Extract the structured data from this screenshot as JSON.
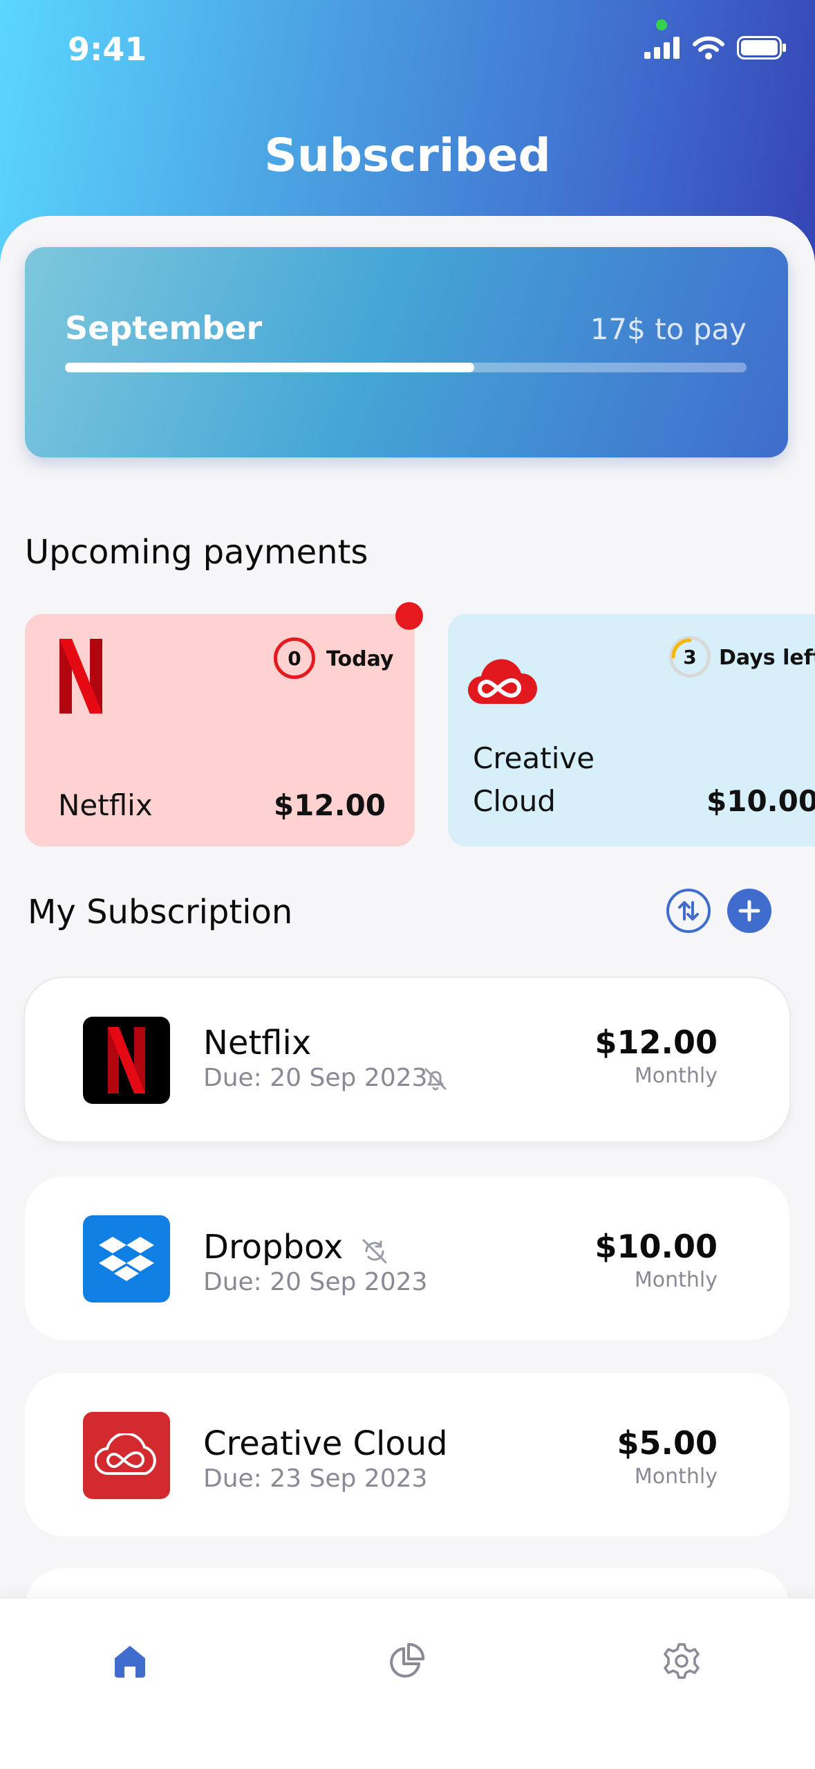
{
  "status_bar": {
    "time": "9:41"
  },
  "header": {
    "title": "Subscribed"
  },
  "month_card": {
    "month": "September",
    "to_pay": "17$ to pay",
    "progress_fraction": 0.6
  },
  "upcoming": {
    "title": "Upcoming payments",
    "cards": [
      {
        "name": "Netflix",
        "price": "$12.00",
        "days": "0",
        "badge_label": "Today",
        "color": "#ffd2d2"
      },
      {
        "name_line1": "Creative",
        "name_line2": "Cloud",
        "price": "$10.00",
        "days": "3",
        "badge_label": "Days left",
        "color": "#d7eff9"
      }
    ]
  },
  "subscriptions": {
    "title": "My Subscription",
    "items": [
      {
        "name": "Netflix",
        "due": "Due: 20 Sep 2023",
        "price": "$12.00",
        "cycle": "Monthly",
        "icon": "netflix-logo",
        "status_icon": "bell-off-icon"
      },
      {
        "name": "Dropbox",
        "due": "Due: 20 Sep 2023",
        "price": "$10.00",
        "cycle": "Monthly",
        "icon": "dropbox-logo",
        "status_icon": "autorenew-off-icon"
      },
      {
        "name": "Creative Cloud",
        "due": "Due: 23 Sep 2023",
        "price": "$5.00",
        "cycle": "Monthly",
        "icon": "creative-cloud-logo"
      }
    ]
  },
  "tabbar": {
    "items": [
      "home-icon",
      "chart-icon",
      "settings-icon"
    ],
    "active": "home-icon"
  },
  "colors": {
    "accent": "#3f6ccd",
    "netflix_red": "#e50914",
    "dropbox_blue": "#0f7fe3",
    "adobe_red": "#d22a2f"
  }
}
